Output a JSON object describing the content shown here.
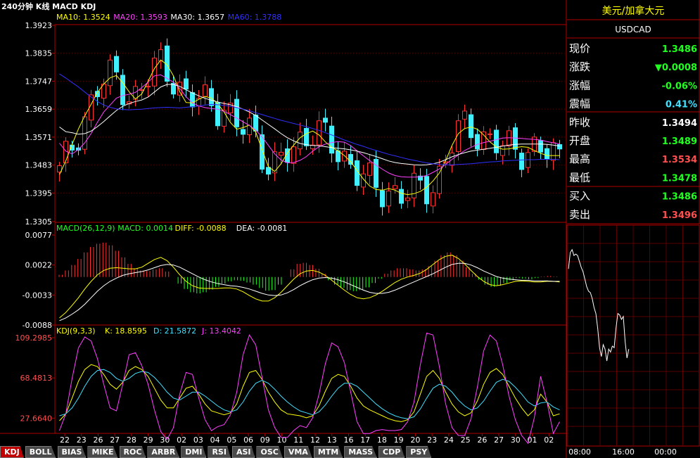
{
  "header": {
    "title": "240分钟 K线 MACD KDJ",
    "ma_labels": [
      {
        "text": "MA10: 1.3524",
        "color": "#ffff00"
      },
      {
        "text": "MA20: 1.3593",
        "color": "#ff40ff"
      },
      {
        "text": "MA30: 1.3657",
        "color": "#ffffff"
      },
      {
        "text": "MA60: 1.3788",
        "color": "#3030ff"
      }
    ]
  },
  "price_axis": [
    "1.3923",
    "1.3835",
    "1.3747",
    "1.3659",
    "1.3571",
    "1.3483",
    "1.3395",
    "1.3305"
  ],
  "macd_header": [
    {
      "text": "MACD(26,12,9)",
      "color": "#20ff20"
    },
    {
      "text": "MACD: 0.0014",
      "color": "#20ff20"
    },
    {
      "text": "DIFF: -0.0088",
      "color": "#ffff00"
    },
    {
      "text": "DEA: -0.0081",
      "color": "#ffffff"
    }
  ],
  "macd_axis": [
    "0.0077",
    "0.0022",
    "-0.0033",
    "-0.0088"
  ],
  "kdj_header": [
    {
      "text": "KDJ(9,3,3)",
      "color": "#ffff00"
    },
    {
      "text": "K: 18.8595",
      "color": "#ffff00"
    },
    {
      "text": "D: 21.5872",
      "color": "#40e0ff"
    },
    {
      "text": "J: 13.4042",
      "color": "#ff40ff"
    }
  ],
  "kdj_axis": [
    "109.2985",
    "68.4813",
    "27.6640"
  ],
  "date_labels": [
    "22",
    "23",
    "26",
    "27",
    "28",
    "29",
    "30",
    "02",
    "03",
    "04",
    "05",
    "06",
    "09",
    "10",
    "11",
    "12",
    "13",
    "16",
    "17",
    "18",
    "19",
    "20",
    "23",
    "24",
    "25",
    "26",
    "27",
    "30",
    "01",
    "02"
  ],
  "tabs": [
    "KDJ",
    "BOLL",
    "BIAS",
    "MIKE",
    "ROC",
    "ARBR",
    "DMI",
    "RSI",
    "ASI",
    "OSC",
    "VMA",
    "MTM",
    "MASS",
    "CDP",
    "PSY"
  ],
  "quote": {
    "name": "美元/加拿大元",
    "symbol": "USDCAD",
    "rows": [
      {
        "label": "现价",
        "value": "1.3486",
        "color": "#20ff20"
      },
      {
        "label": "涨跌",
        "value": "▼0.0008",
        "color": "#20ff20"
      },
      {
        "label": "涨幅",
        "value": "-0.06%",
        "color": "#20ff20"
      },
      {
        "label": "震幅",
        "value": "0.41%",
        "color": "#40e0ff"
      },
      {
        "label": "昨收",
        "value": "1.3494",
        "color": "#ffffff"
      },
      {
        "label": "开盘",
        "value": "1.3489",
        "color": "#20ff20"
      },
      {
        "label": "最高",
        "value": "1.3534",
        "color": "#ff5050"
      },
      {
        "label": "最低",
        "value": "1.3478",
        "color": "#20ff20"
      },
      {
        "label": "买入",
        "value": "1.3486",
        "color": "#20ff20"
      },
      {
        "label": "卖出",
        "value": "1.3496",
        "color": "#ff5050"
      }
    ]
  },
  "intraday_times": [
    "08:00",
    "16:00",
    "00:00"
  ],
  "chart_data": [
    {
      "type": "candlestick",
      "title": "240分钟 K线",
      "ylim": [
        1.3305,
        1.3923
      ],
      "series": [
        {
          "name": "MA10",
          "color": "#ffff00",
          "values": [
            1.3453,
            1.3496,
            1.3548,
            1.3597,
            1.3638,
            1.3674,
            1.3712,
            1.3738,
            1.3758,
            1.3765,
            1.3742,
            1.3714,
            1.3691,
            1.3707,
            1.3747,
            1.3787,
            1.3814,
            1.3799,
            1.3764,
            1.3714,
            1.368,
            1.3679,
            1.369,
            1.3699,
            1.3694,
            1.3676,
            1.365,
            1.3617,
            1.3596,
            1.3601,
            1.3609,
            1.3587,
            1.3532,
            1.3478,
            1.3463,
            1.3487,
            1.3521,
            1.3546,
            1.3569,
            1.3582,
            1.359,
            1.3578,
            1.3556,
            1.3539,
            1.3528,
            1.3513,
            1.3494,
            1.3466,
            1.3439,
            1.3417,
            1.3406,
            1.3404,
            1.3409,
            1.3404,
            1.3394,
            1.339,
            1.3393,
            1.34,
            1.3413,
            1.3433,
            1.3458,
            1.3497,
            1.3545,
            1.3582,
            1.3598,
            1.3603,
            1.3596,
            1.3578,
            1.3556,
            1.354,
            1.3533,
            1.3534,
            1.3538,
            1.3541,
            1.3539,
            1.3529,
            1.352,
            1.3513,
            1.3513,
            1.3513
          ]
        },
        {
          "name": "MA20",
          "color": "#ff40ff",
          "values": [
            1.3552,
            1.3527,
            1.3518,
            1.3532,
            1.3553,
            1.3582,
            1.3618,
            1.365,
            1.3672,
            1.3694,
            1.3702,
            1.3706,
            1.3712,
            1.3727,
            1.3744,
            1.3764,
            1.3767,
            1.3756,
            1.3744,
            1.3724,
            1.3698,
            1.3679,
            1.3669,
            1.3664,
            1.3661,
            1.3659,
            1.3652,
            1.3642,
            1.3631,
            1.3619,
            1.3608,
            1.3593,
            1.3572,
            1.3545,
            1.3518,
            1.3499,
            1.349,
            1.3491,
            1.3498,
            1.351,
            1.3527,
            1.3541,
            1.3549,
            1.3554,
            1.3557,
            1.3555,
            1.3544,
            1.3528,
            1.3512,
            1.3497,
            1.3483,
            1.347,
            1.3458,
            1.345,
            1.3446,
            1.3445,
            1.3445,
            1.3446,
            1.345,
            1.346,
            1.3471,
            1.3485,
            1.3501,
            1.3515,
            1.3529,
            1.3539,
            1.3548,
            1.3554,
            1.3558,
            1.3563,
            1.3568,
            1.3569,
            1.3568,
            1.3567,
            1.3565,
            1.3564,
            1.3562,
            1.3557,
            1.3553,
            1.3549
          ]
        },
        {
          "name": "MA30",
          "color": "#ffffff",
          "values": [
            1.3603,
            1.3588,
            1.3585,
            1.358,
            1.3582,
            1.359,
            1.3604,
            1.362,
            1.3638,
            1.3655,
            1.3668,
            1.3677,
            1.3683,
            1.3688,
            1.3697,
            1.3713,
            1.3729,
            1.3737,
            1.3737,
            1.3731,
            1.372,
            1.371,
            1.3701,
            1.3693,
            1.3687,
            1.3682,
            1.3677,
            1.3673,
            1.3667,
            1.3659,
            1.365,
            1.3639,
            1.3625,
            1.3611,
            1.3597,
            1.3582,
            1.3569,
            1.3559,
            1.3551,
            1.3547,
            1.3545,
            1.3544,
            1.3541,
            1.3538,
            1.3536,
            1.3534,
            1.3531,
            1.3527,
            1.3522,
            1.3516,
            1.351,
            1.3503,
            1.3496,
            1.3491,
            1.3488,
            1.3486,
            1.3484,
            1.3483,
            1.3484,
            1.3487,
            1.3492,
            1.35,
            1.3509,
            1.3516,
            1.3522,
            1.3527,
            1.353,
            1.3533,
            1.3536,
            1.3539,
            1.3543,
            1.3546,
            1.3548,
            1.3549,
            1.3549,
            1.3549,
            1.3549,
            1.3548,
            1.3546,
            1.3543
          ]
        },
        {
          "name": "MA60",
          "color": "#3030ff",
          "values": [
            1.377,
            1.3757,
            1.3743,
            1.3729,
            1.3713,
            1.3697,
            1.3683,
            1.3672,
            1.3665,
            1.366,
            1.3658,
            1.3657,
            1.3658,
            1.3659,
            1.3661,
            1.3663,
            1.3664,
            1.3665,
            1.3664,
            1.3663,
            1.3665,
            1.3667,
            1.3669,
            1.3672,
            1.3674,
            1.3673,
            1.3671,
            1.3668,
            1.3664,
            1.3659,
            1.3654,
            1.3648,
            1.3642,
            1.3636,
            1.363,
            1.3624,
            1.3619,
            1.3614,
            1.3609,
            1.3604,
            1.3598,
            1.3592,
            1.3585,
            1.3578,
            1.357,
            1.3562,
            1.3555,
            1.3548,
            1.3542,
            1.3535,
            1.3529,
            1.3523,
            1.3517,
            1.3512,
            1.3507,
            1.3502,
            1.3498,
            1.3494,
            1.349,
            1.3487,
            1.3485,
            1.3484,
            1.3484,
            1.3485,
            1.3486,
            1.3487,
            1.3489,
            1.3491,
            1.3493,
            1.3494,
            1.3496,
            1.3497,
            1.3498,
            1.3499,
            1.35,
            1.35,
            1.3501,
            1.3501,
            1.3501,
            1.35
          ]
        }
      ]
    },
    {
      "type": "bar",
      "title": "MACD(26,12,9)",
      "ylim": [
        -0.0088,
        0.0077
      ],
      "series": [
        {
          "name": "MACD",
          "values": [
            0.0004,
            0.0012,
            0.0022,
            0.0033,
            0.0045,
            0.0055,
            0.0061,
            0.0063,
            0.0058,
            0.0048,
            0.0036,
            0.0024,
            0.0016,
            0.0012,
            0.0011,
            0.0014,
            0.0016,
            0.001,
            0.0,
            -0.0012,
            -0.0022,
            -0.0028,
            -0.003,
            -0.0028,
            -0.0023,
            -0.0018,
            -0.0012,
            -0.0008,
            -0.0006,
            -0.0007,
            -0.001,
            -0.0014,
            -0.002,
            -0.0025,
            -0.0024,
            -0.0014,
            0.0,
            0.0014,
            0.0024,
            0.0026,
            0.0022,
            0.0015,
            0.0006,
            -0.0006,
            -0.0014,
            -0.002,
            -0.0024,
            -0.0026,
            -0.0024,
            -0.0019,
            -0.0011,
            -0.0003,
            0.0006,
            0.0012,
            0.0016,
            0.0016,
            0.0014,
            0.0012,
            0.0014,
            0.002,
            0.003,
            0.004,
            0.0045,
            0.004,
            0.003,
            0.0018,
            0.0006,
            -0.0005,
            -0.0014,
            -0.0018,
            -0.0016,
            -0.0011,
            -0.0006,
            -0.0002,
            -0.0003,
            -0.0004,
            -0.0002,
            0.0001,
            0.0002,
            0.0001
          ]
        },
        {
          "name": "DIFF",
          "values": [
            -0.0075,
            -0.0065,
            -0.0052,
            -0.0038,
            -0.0022,
            -0.0008,
            0.0004,
            0.0012,
            0.0016,
            0.0017,
            0.0016,
            0.0015,
            0.0015,
            0.0018,
            0.0025,
            0.0032,
            0.0036,
            0.003,
            0.0018,
            0.0004,
            -0.0008,
            -0.0016,
            -0.002,
            -0.0021,
            -0.0021,
            -0.0021,
            -0.002,
            -0.002,
            -0.0022,
            -0.0027,
            -0.0034,
            -0.004,
            -0.0044,
            -0.0044,
            -0.0038,
            -0.0028,
            -0.0016,
            -0.0004,
            0.0006,
            0.0011,
            0.0012,
            0.0009,
            0.0003,
            -0.0006,
            -0.0015,
            -0.0024,
            -0.0032,
            -0.0038,
            -0.004,
            -0.0038,
            -0.0033,
            -0.0026,
            -0.0018,
            -0.001,
            -0.0004,
            0.0,
            0.0003,
            0.0007,
            0.0014,
            0.0023,
            0.0032,
            0.0038,
            0.004,
            0.0034,
            0.0024,
            0.0012,
            0.0001,
            -0.0008,
            -0.0014,
            -0.0016,
            -0.0014,
            -0.0011,
            -0.0008,
            -0.0007,
            -0.0008,
            -0.0009,
            -0.0009,
            -0.0008,
            -0.0008,
            -0.0009
          ]
        },
        {
          "name": "DEA",
          "values": [
            -0.008,
            -0.0075,
            -0.0068,
            -0.006,
            -0.005,
            -0.0038,
            -0.0026,
            -0.0016,
            -0.0008,
            -0.0002,
            0.0003,
            0.0006,
            0.0008,
            0.001,
            0.0013,
            0.0017,
            0.0021,
            0.0023,
            0.0022,
            0.0018,
            0.0012,
            0.0006,
            0.0,
            -0.0005,
            -0.0009,
            -0.0012,
            -0.0014,
            -0.0016,
            -0.0017,
            -0.0019,
            -0.0022,
            -0.0026,
            -0.003,
            -0.0033,
            -0.0034,
            -0.0033,
            -0.0029,
            -0.0023,
            -0.0016,
            -0.001,
            -0.0005,
            -0.0002,
            -0.0001,
            -0.0002,
            -0.0005,
            -0.0009,
            -0.0014,
            -0.0019,
            -0.0024,
            -0.0028,
            -0.003,
            -0.003,
            -0.0028,
            -0.0024,
            -0.0019,
            -0.0014,
            -0.0009,
            -0.0004,
            0.0001,
            0.0006,
            0.0012,
            0.0018,
            0.0023,
            0.0025,
            0.0025,
            0.0022,
            0.0017,
            0.0011,
            0.0006,
            0.0001,
            -0.0002,
            -0.0004,
            -0.0005,
            -0.0006,
            -0.0006,
            -0.0007,
            -0.0007,
            -0.0007,
            -0.0008,
            -0.0008
          ]
        }
      ]
    },
    {
      "type": "line",
      "title": "KDJ(9,3,3)",
      "ylim": [
        15,
        109.2985
      ],
      "series": [
        {
          "name": "K",
          "values": [
            25,
            32,
            48,
            65,
            77,
            82,
            80,
            72,
            62,
            57,
            64,
            76,
            80,
            77,
            70,
            58,
            46,
            38,
            38,
            48,
            58,
            60,
            52,
            42,
            35,
            33,
            31,
            33,
            42,
            60,
            74,
            76,
            67,
            54,
            44,
            36,
            32,
            31,
            30,
            28,
            30,
            40,
            55,
            68,
            72,
            70,
            60,
            48,
            40,
            36,
            33,
            30,
            27,
            25,
            24,
            26,
            34,
            52,
            70,
            76,
            68,
            54,
            42,
            34,
            30,
            33,
            45,
            62,
            74,
            78,
            72,
            60,
            48,
            38,
            30,
            36,
            52,
            44,
            30,
            32
          ]
        },
        {
          "name": "D",
          "values": [
            30,
            32,
            38,
            48,
            60,
            70,
            76,
            77,
            74,
            68,
            65,
            68,
            73,
            75,
            74,
            69,
            62,
            54,
            48,
            46,
            50,
            54,
            54,
            50,
            45,
            40,
            36,
            34,
            36,
            44,
            55,
            63,
            66,
            63,
            57,
            50,
            44,
            39,
            35,
            33,
            31,
            34,
            41,
            50,
            58,
            63,
            63,
            60,
            54,
            48,
            42,
            37,
            33,
            30,
            28,
            27,
            29,
            37,
            48,
            58,
            62,
            60,
            54,
            46,
            40,
            36,
            38,
            45,
            55,
            64,
            67,
            65,
            59,
            52,
            44,
            40,
            43,
            44,
            39,
            36
          ]
        },
        {
          "name": "J",
          "values": [
            15,
            32,
            68,
            99,
            110,
            106,
            88,
            62,
            38,
            35,
            62,
            92,
            94,
            81,
            62,
            36,
            14,
            6,
            18,
            52,
            74,
            72,
            48,
            26,
            15,
            19,
            21,
            31,
            54,
            92,
            112,
            102,
            69,
            36,
            18,
            8,
            8,
            15,
            20,
            18,
            28,
            52,
            83,
            104,
            100,
            84,
            54,
            24,
            12,
            12,
            15,
            16,
            15,
            15,
            16,
            24,
            44,
            82,
            114,
            112,
            80,
            42,
            18,
            10,
            10,
            27,
            59,
            96,
            112,
            106,
            82,
            50,
            26,
            10,
            2,
            28,
            70,
            44,
            12,
            24
          ]
        }
      ]
    },
    {
      "type": "line",
      "title": "intraday",
      "values": [
        1.354,
        1.3551,
        1.3553,
        1.3549,
        1.355,
        1.3549,
        1.3545,
        1.3541,
        1.3538,
        1.3533,
        1.3528,
        1.3525,
        1.3524,
        1.352,
        1.3514,
        1.351,
        1.35,
        1.3487,
        1.3481,
        1.3489,
        1.3486,
        1.3478,
        1.3486,
        1.3484,
        1.3488,
        1.3487,
        1.35,
        1.351,
        1.3509,
        1.3506,
        1.3508,
        1.3491,
        1.348,
        1.3486
      ]
    }
  ]
}
